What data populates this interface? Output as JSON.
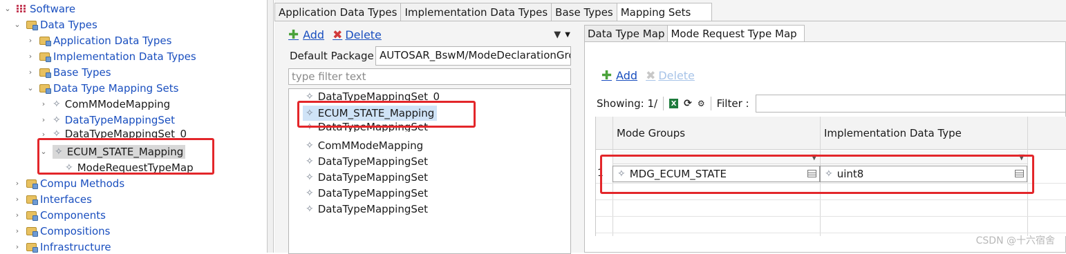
{
  "tree": {
    "root": "Software",
    "data_types": "Data Types",
    "application_data_types": "Application Data Types",
    "implementation_data_types": "Implementation Data Types",
    "base_types": "Base Types",
    "data_type_mapping_sets": "Data Type Mapping Sets",
    "mapping_items": [
      "ComMModeMapping",
      "DataTypeMappingSet",
      "DataTypeMappingSet_0",
      "ECUM_STATE_Mapping"
    ],
    "mode_request_type_map": "ModeRequestTypeMap",
    "compu_methods": "Compu Methods",
    "interfaces": "Interfaces",
    "components": "Components",
    "compositions": "Compositions",
    "infrastructure": "Infrastructure"
  },
  "editor_tabs": [
    "Application Data Types",
    "Implementation Data Types",
    "Base Types",
    "Mapping Sets"
  ],
  "list_panel": {
    "add_label": "Add",
    "delete_label": "Delete",
    "default_package_label": "Default Package",
    "default_package_value": "AUTOSAR_BswM/ModeDeclarationGro",
    "filter_placeholder": "type filter text",
    "items": [
      "DataTypeMappingSet_0",
      "ECUM_STATE_Mapping",
      "DataTypeMappingSet",
      "ComMModeMapping",
      "DataTypeMappingSet",
      "DataTypeMappingSet",
      "DataTypeMappingSet",
      "DataTypeMappingSet"
    ]
  },
  "detail_panel": {
    "tabs": [
      "Data Type Map",
      "Mode Request Type Map"
    ],
    "add_label": "Add",
    "delete_label": "Delete",
    "showing_label": "Showing: 1/",
    "filter_label": "Filter :",
    "columns": [
      "Mode Groups",
      "Implementation Data Type"
    ],
    "rows": [
      {
        "num": "1",
        "mode_group": "MDG_ECUM_STATE",
        "impl_type": "uint8"
      }
    ]
  },
  "watermark": "CSDN @十六宿舍",
  "colors": {
    "link": "#1a4fbf",
    "annotation": "#e3262a",
    "selection": "#cfe3f7",
    "add_icon": "#4aa23a",
    "delete_icon": "#d23a3a"
  },
  "icons": [
    "chevron-down-icon",
    "chevron-right-icon",
    "folder-package-icon",
    "autosar-element-icon",
    "add-icon",
    "delete-icon",
    "filter-icon",
    "excel-export-icon",
    "refresh-icon",
    "settings-icon",
    "cell-edit-icon"
  ]
}
